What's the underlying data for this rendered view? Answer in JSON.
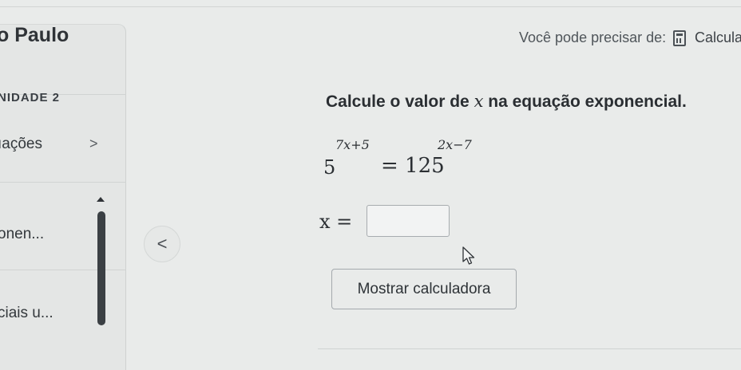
{
  "sidebar": {
    "title": "o Paulo",
    "unit": "NIDADE 2",
    "items": [
      {
        "label": "ıações",
        "chevron": ">"
      },
      {
        "label": "onen..."
      },
      {
        "label": "ciais u..."
      }
    ]
  },
  "collapse_button": {
    "glyph": "<"
  },
  "hint": {
    "text": "Você pode precisar de:",
    "icon": "calculator-icon",
    "link": "Calcula"
  },
  "question": {
    "prefix": "Calcule o valor de ",
    "variable": "x",
    "suffix": " na equação exponencial."
  },
  "equation": {
    "left_base": "5",
    "left_exponent": "7x+5",
    "relation": "= 125",
    "right_exponent": "2x−7"
  },
  "answer": {
    "label": "x =",
    "value": ""
  },
  "calculator_button": {
    "label": "Mostrar calculadora"
  }
}
